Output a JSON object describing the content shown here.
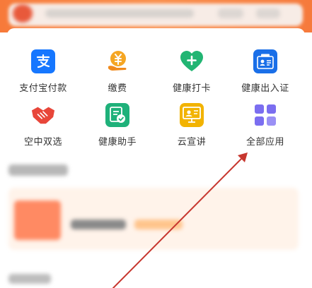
{
  "colors": {
    "header": "#f77a3a",
    "label": "#333333",
    "arrow": "#c7372f",
    "alipay_blue": "#1677ff",
    "health_green": "#22b573",
    "pay_orange": "#f5a623",
    "cloud_yellow": "#f2b300",
    "all_apps_purple": "#7b6ef0",
    "card_orange": "#ff8a63"
  },
  "apps": [
    {
      "label": "支付宝付款",
      "icon": "alipay-icon"
    },
    {
      "label": "缴费",
      "icon": "yuan-bill-icon"
    },
    {
      "label": "健康打卡",
      "icon": "heart-plus-icon"
    },
    {
      "label": "健康出入证",
      "icon": "health-pass-icon"
    },
    {
      "label": "空中双选",
      "icon": "handshake-icon"
    },
    {
      "label": "健康助手",
      "icon": "health-assistant-icon"
    },
    {
      "label": "云宣讲",
      "icon": "cloud-lecture-icon"
    },
    {
      "label": "全部应用",
      "icon": "grid-apps-icon"
    }
  ]
}
